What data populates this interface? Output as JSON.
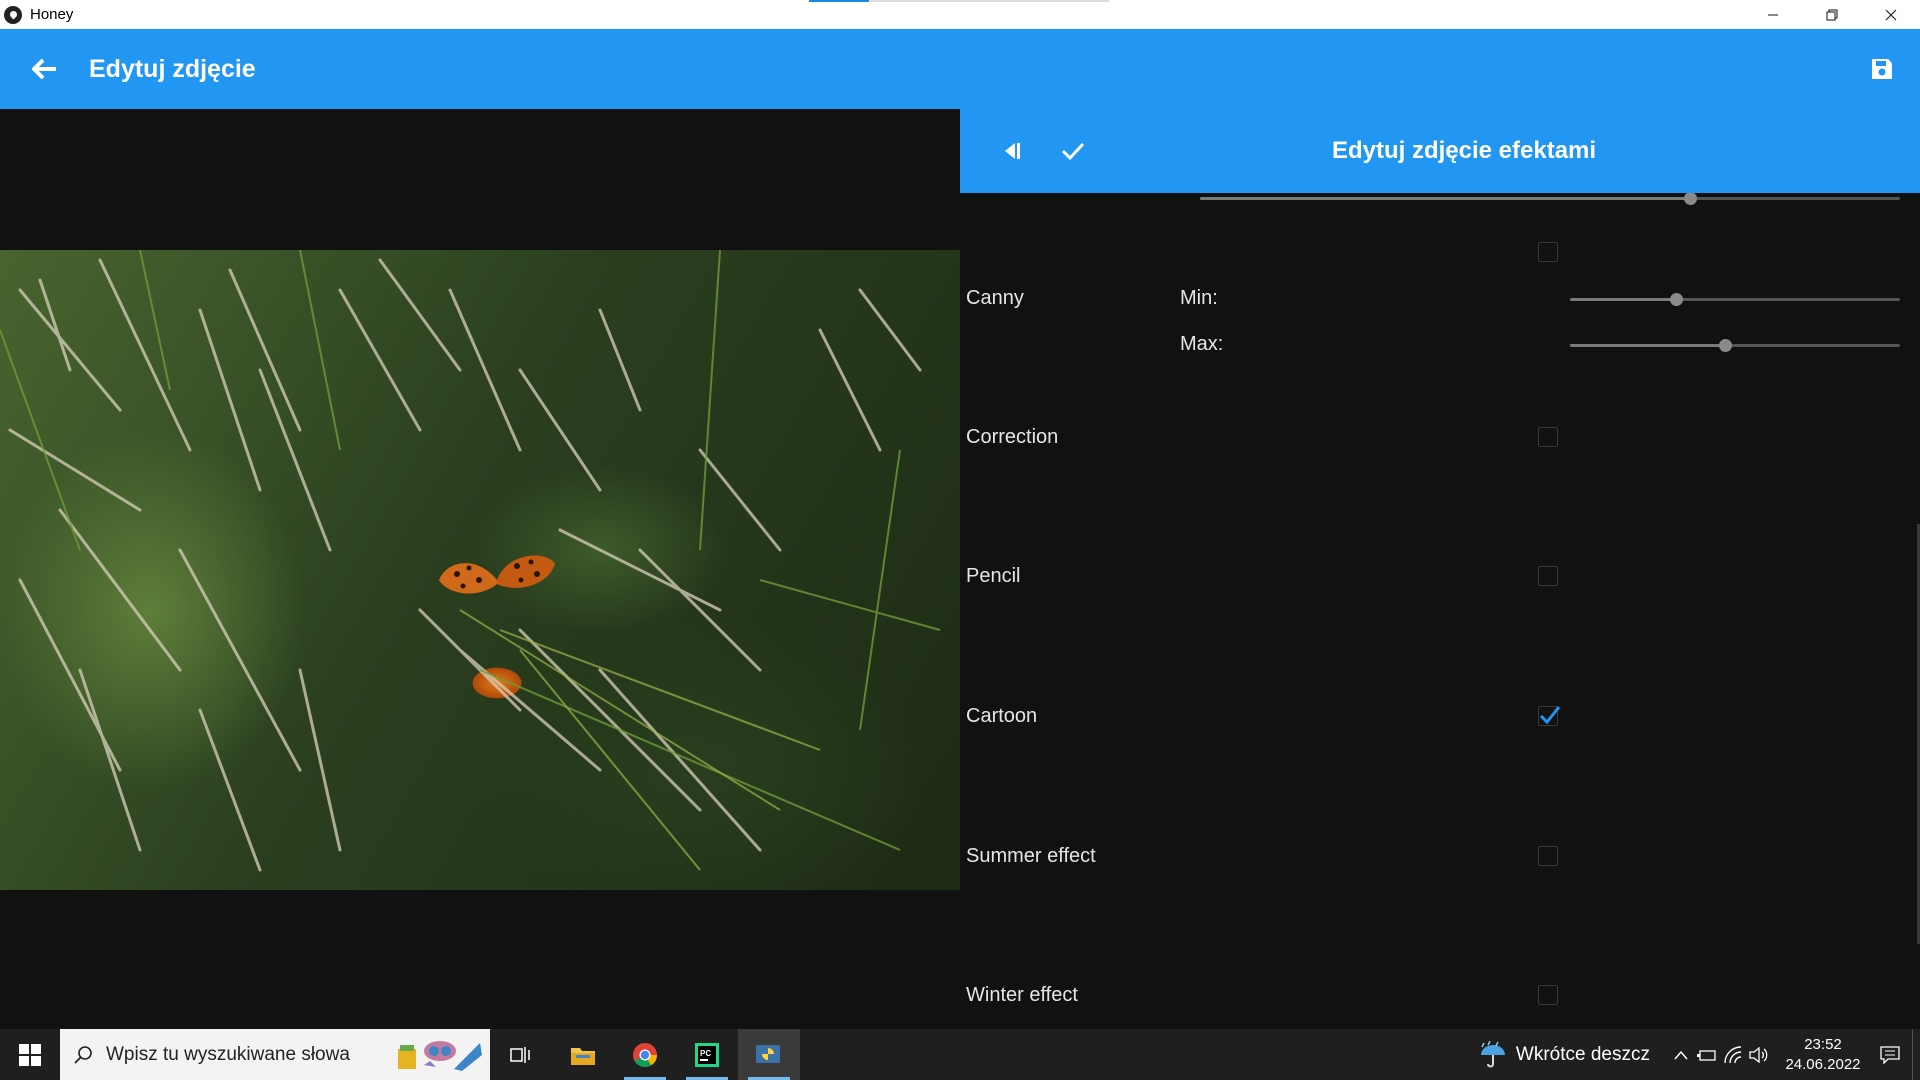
{
  "window": {
    "app_title": "Honey"
  },
  "header": {
    "title": "Edytuj zdjęcie"
  },
  "effects_panel": {
    "title": "Edytuj zdjęcie efektami",
    "top_slider_value": 0.7,
    "effects": [
      {
        "label": "",
        "checked": false
      },
      {
        "label": "Canny",
        "params": [
          {
            "label": "Min:",
            "value": 0.32
          },
          {
            "label": "Max:",
            "value": 0.47
          }
        ]
      },
      {
        "label": "Correction",
        "checked": false
      },
      {
        "label": "Pencil",
        "checked": false
      },
      {
        "label": "Cartoon",
        "checked": true
      },
      {
        "label": "Summer effect",
        "checked": false
      },
      {
        "label": "Winter effect",
        "checked": false
      }
    ]
  },
  "taskbar": {
    "search_placeholder": "Wpisz tu wyszukiwane słowa",
    "weather_text": "Wkrótce deszcz",
    "time": "23:52",
    "date": "24.06.2022",
    "pinned": [
      "task-view",
      "file-explorer",
      "chrome",
      "pycharm",
      "python-app"
    ]
  },
  "colors": {
    "accent": "#2196f3",
    "checkbox_checked": "#2196f3"
  }
}
